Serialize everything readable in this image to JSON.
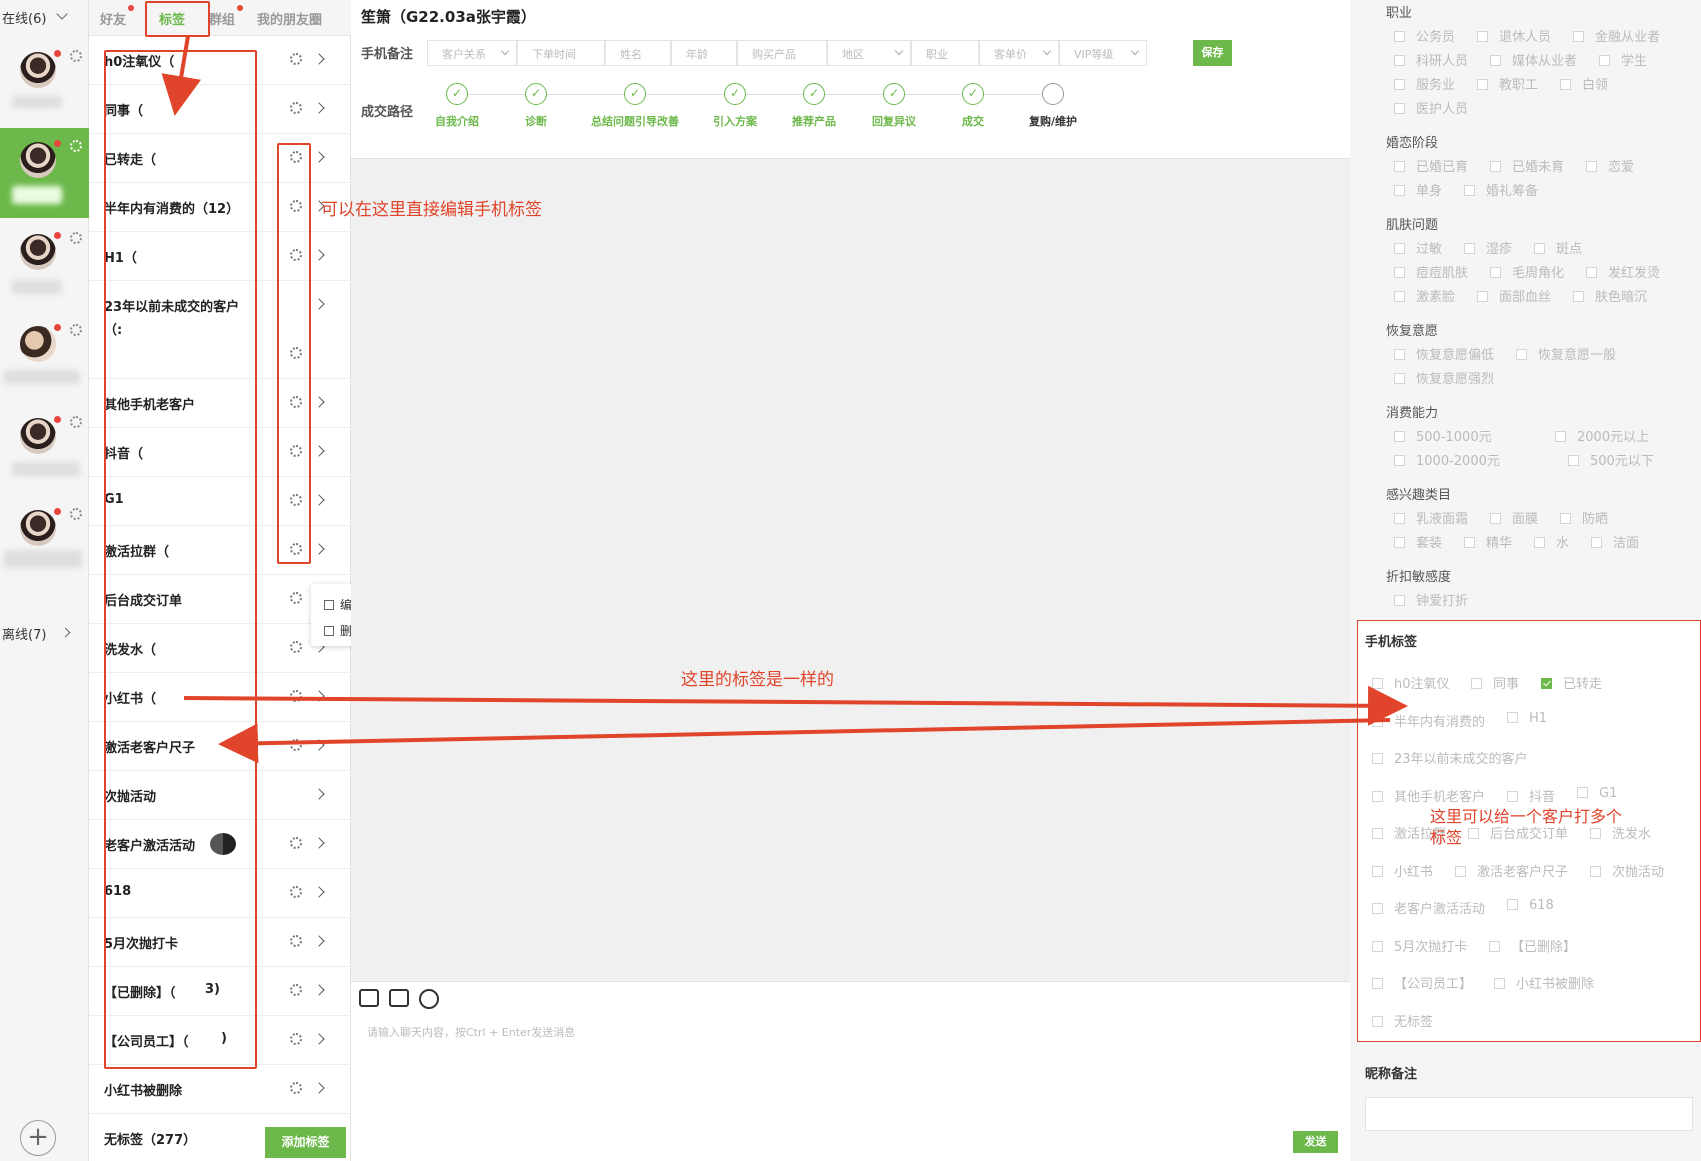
{
  "accounts": {
    "online_label": "在线(6)",
    "offline_label": "离线(7)",
    "add_label": "+"
  },
  "tag_tabs": [
    {
      "label": "好友"
    },
    {
      "label": "标签"
    },
    {
      "label": "群组"
    },
    {
      "label": "我的朋友圈"
    }
  ],
  "tags": [
    {
      "label": "h0注氧仪（"
    },
    {
      "label": "同事（"
    },
    {
      "label": "已转走（"
    },
    {
      "label": "半年内有消费的（12）"
    },
    {
      "label": "H1（"
    },
    {
      "label": "23年以前未成交的客户"
    },
    {
      "label": "其他手机老客户"
    },
    {
      "label": "抖音（"
    },
    {
      "label": "G1"
    },
    {
      "label": "激活拉群（"
    },
    {
      "label": "后台成交订单"
    },
    {
      "label": "洗发水（"
    },
    {
      "label": "小红书（"
    },
    {
      "label": "激活老客户尺子"
    },
    {
      "label": "次抛活动"
    },
    {
      "label": "老客户激活活动"
    },
    {
      "label": "618"
    },
    {
      "label": "5月次抛打卡"
    },
    {
      "label": "【已删除】（"
    },
    {
      "label": "【公司员工】（"
    },
    {
      "label": "小红书被删除"
    },
    {
      "label": "无标签（277）"
    }
  ],
  "tag_row23_extra": "（:",
  "tag_deleted_suffix": "3)",
  "tag_staff_suffix": ")",
  "context_menu": {
    "edit": "编辑",
    "delete": "删除"
  },
  "add_tag_button": "添加标签",
  "chat": {
    "title": "笙箫（G22.03a张宇霞）",
    "phone_note_label": "手机备注",
    "fields": [
      "客户关系",
      "下单时间",
      "姓名",
      "年龄",
      "购买产品",
      "地区",
      "职业",
      "客单价",
      "VIP等级"
    ],
    "save_label": "保存",
    "path_label": "成交路径",
    "steps": [
      {
        "label": "自我介绍",
        "done": true
      },
      {
        "label": "诊断",
        "done": true
      },
      {
        "label": "总结问题引导改善",
        "done": true
      },
      {
        "label": "引入方案",
        "done": true
      },
      {
        "label": "推荐产品",
        "done": true
      },
      {
        "label": "回复异议",
        "done": true
      },
      {
        "label": "成交",
        "done": true
      },
      {
        "label": "复购/维护",
        "done": false
      }
    ],
    "input_placeholder": "请输入聊天内容，按Ctrl + Enter发送消息",
    "send_label": "发送"
  },
  "profile": {
    "sections": [
      {
        "title": "职业",
        "rows": [
          [
            "公务员",
            "退休人员",
            "金融从业者"
          ],
          [
            "科研人员",
            "媒体从业者",
            "学生"
          ],
          [
            "服务业",
            "教职工",
            "白领"
          ],
          [
            "医护人员"
          ]
        ]
      },
      {
        "title": "婚恋阶段",
        "rows": [
          [
            "已婚已育",
            "已婚未育",
            "恋爱"
          ],
          [
            "单身",
            "婚礼筹备"
          ]
        ]
      },
      {
        "title": "肌肤问题",
        "rows": [
          [
            "过敏",
            "湿疹",
            "斑点"
          ],
          [
            "痘痘肌肤",
            "毛周角化",
            "发红发烫"
          ],
          [
            "激素脸",
            "面部血丝",
            "肤色暗沉"
          ]
        ]
      },
      {
        "title": "恢复意愿",
        "rows": [
          [
            "恢复意愿偏低",
            "恢复意愿一般"
          ],
          [
            "恢复意愿强烈"
          ]
        ]
      },
      {
        "title": "消费能力",
        "rows": [
          [
            "500-1000元",
            "2000元以上"
          ],
          [
            "1000-2000元",
            "500元以下"
          ]
        ]
      },
      {
        "title": "感兴趣类目",
        "rows": [
          [
            "乳液面霜",
            "面膜",
            "防晒"
          ],
          [
            "套装",
            "精华",
            "水",
            "洁面"
          ]
        ]
      },
      {
        "title": "折扣敏感度",
        "rows": [
          [
            "钟爱打折"
          ]
        ]
      }
    ],
    "phone_tags_title": "手机标签",
    "phone_tags_rows": [
      [
        {
          "label": "h0注氧仪",
          "checked": false
        },
        {
          "label": "同事",
          "checked": false
        },
        {
          "label": "已转走",
          "checked": true
        }
      ],
      [
        {
          "label": "半年内有消费的",
          "checked": false
        },
        {
          "label": "H1",
          "checked": false
        }
      ],
      [
        {
          "label": "23年以前未成交的客户",
          "checked": false
        }
      ],
      [
        {
          "label": "其他手机老客户",
          "checked": false
        },
        {
          "label": "抖音",
          "checked": false
        },
        {
          "label": "G1",
          "checked": false
        }
      ],
      [
        {
          "label": "激活拉群",
          "checked": false
        },
        {
          "label": "后台成交订单",
          "checked": false
        },
        {
          "label": "洗发水",
          "checked": false
        }
      ],
      [
        {
          "label": "小红书",
          "checked": false
        },
        {
          "label": "激活老客户尺子",
          "checked": false
        },
        {
          "label": "次抛活动",
          "checked": false
        }
      ],
      [
        {
          "label": "老客户激活活动",
          "checked": false
        },
        {
          "label": "618",
          "checked": false
        }
      ],
      [
        {
          "label": "5月次抛打卡",
          "checked": false
        },
        {
          "label": "【已删除】",
          "checked": false
        }
      ],
      [
        {
          "label": "【公司员工】",
          "checked": false
        },
        {
          "label": "小红书被删除",
          "checked": false
        }
      ],
      [
        {
          "label": "无标签",
          "checked": false
        }
      ]
    ],
    "nickname_label": "昵称备注"
  },
  "annotations": {
    "edit_hint": "可以在这里直接编辑手机标签",
    "same_tags_hint": "这里的标签是一样的",
    "multi_tag_hint_line1": "这里可以给一个客户打多个",
    "multi_tag_hint_line2": "标签"
  },
  "colors": {
    "brand_green": "#6cb84a",
    "annotation_red": "#e0442a"
  }
}
